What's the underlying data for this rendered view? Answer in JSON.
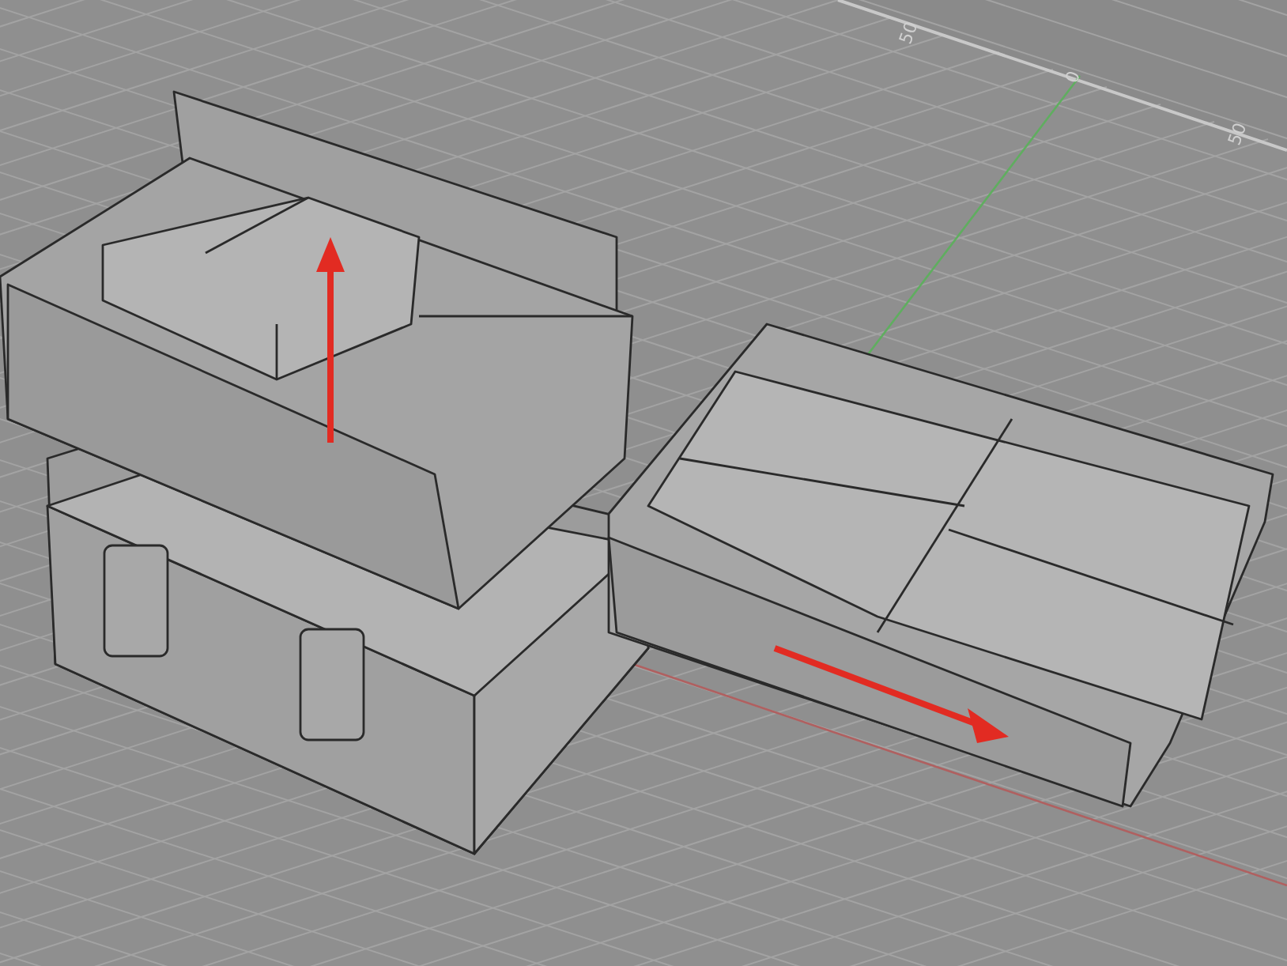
{
  "viewport": {
    "grid_labels": [
      "50",
      "0",
      "50"
    ]
  }
}
